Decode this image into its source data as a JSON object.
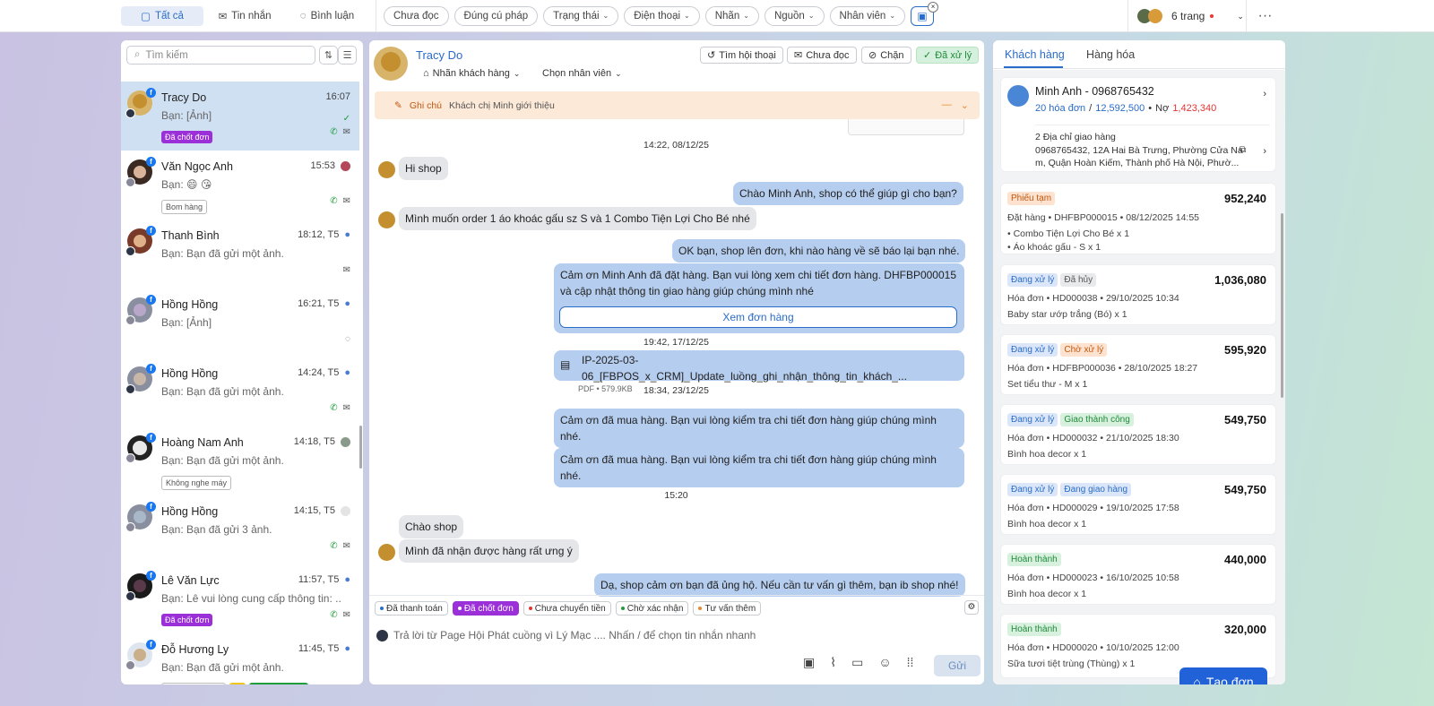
{
  "topbar": {
    "segments": [
      {
        "label": "Tất cả",
        "icon": "chat-bubble-icon"
      },
      {
        "label": "Tin nhắn",
        "icon": "mail-icon"
      },
      {
        "label": "Bình luận",
        "icon": "comment-icon"
      }
    ],
    "filters": [
      "Chưa đọc",
      "Đúng cú pháp",
      "Trạng thái",
      "Điện thoại",
      "Nhãn",
      "Nguồn",
      "Nhân viên"
    ],
    "pages_label": "6 trang",
    "more_label": "···"
  },
  "left": {
    "search_placeholder": "Tìm kiếm",
    "conversations": [
      {
        "name": "Tracy Do",
        "time": "16:07",
        "message": "Bạn: [Ảnh]",
        "tag": "Đã chốt đơn"
      },
      {
        "name": "Văn Ngọc Anh",
        "time": "15:53",
        "message": "Bạn: 😄 😘",
        "tag": "Bom hàng"
      },
      {
        "name": "Thanh Bình",
        "time": "18:12, T5",
        "message": "Bạn: Bạn đã gửi một ảnh.",
        "tag": ""
      },
      {
        "name": "Hồng Hồng",
        "time": "16:21, T5",
        "message": "Bạn: [Ảnh]",
        "tag": ""
      },
      {
        "name": "Hồng Hồng",
        "time": "14:24, T5",
        "message": "Bạn: Bạn đã gửi một ảnh.",
        "tag": ""
      },
      {
        "name": "Hoàng Nam Anh",
        "time": "14:18, T5",
        "message": "Bạn: Bạn đã gửi một ảnh.",
        "tag": "Không nghe máy"
      },
      {
        "name": "Hồng Hồng",
        "time": "14:15, T5",
        "message": "Bạn: Bạn đã gửi 3 ảnh.",
        "tag": ""
      },
      {
        "name": "Lê Văn Lực",
        "time": "11:57, T5",
        "message": "Bạn: Lê vui lòng cung cấp thông tin: ...",
        "tag": "Đã chốt đơn"
      },
      {
        "name": "Đỗ Hương Ly",
        "time": "11:45, T5",
        "message": "Bạn: Bạn đã gửi một ảnh.",
        "tag": ""
      }
    ]
  },
  "chat": {
    "name": "Tracy Do",
    "label_btn": "Nhãn khách hàng",
    "staff_btn": "Chọn nhân viên",
    "actions": [
      "Tìm hội thoại",
      "Chưa đọc",
      "Chặn",
      "Đã xử lý"
    ],
    "note_label": "Ghi chú",
    "note_text": "Khách chị Minh giới thiệu",
    "messages": {
      "ts1": "14:22, 08/12/25",
      "m1": "Hi shop",
      "m2": "Chào Minh Anh, shop có thể giúp gì cho bạn?",
      "m3": "Mình muốn order 1 áo khoác gấu sz S và 1 Combo Tiện Lợi Cho Bé nhé",
      "m4": "OK bạn, shop lên đơn, khi nào hàng về sẽ báo lại bạn nhé.",
      "m5a": "Cảm ơn Minh Anh đã đặt hàng. Bạn vui lòng xem chi tiết đơn hàng. DHFBP000015",
      "m5b": "và cập nhật thông tin giao hàng giúp chúng mình nhé",
      "view_order": "Xem đơn hàng",
      "ts2": "19:42, 17/12/25",
      "file_name": "IP-2025-03-06_[FBPOS_x_CRM]_Update_luồng_ghi_nhận_thông_tin_khách_...",
      "file_meta": "PDF • 579.9KB",
      "ts3": "18:34, 23/12/25",
      "m6a": "Cảm ơn  đã mua hàng. Bạn vui lòng kiểm tra chi tiết đơn hàng giúp chúng mình",
      "m6b": "nhé.",
      "m7a": "Cảm ơn  đã mua hàng. Bạn vui lòng kiểm tra chi tiết đơn hàng giúp chúng mình",
      "m7b": "nhé.",
      "ts4": "15:20",
      "m8": "Chào shop",
      "m9": "Mình đã nhận được hàng rất ưng ý",
      "m10": "Dạ, shop cảm ơn bạn đã ủng hộ. Nếu cần tư vấn gì thêm, bạn ib shop nhé!"
    },
    "quick_tags": [
      {
        "label": "Đã thanh toán",
        "color": "#2a6cc9"
      },
      {
        "label": "Đã chốt đơn",
        "color": "#ffffff"
      },
      {
        "label": "Chưa chuyển tiền",
        "color": "#e33333"
      },
      {
        "label": "Chờ xác nhận",
        "color": "#1f9d3a"
      },
      {
        "label": "Tư vấn thêm",
        "color": "#e8892b"
      }
    ],
    "compose_placeholder": "Trả lời từ Page Hội Phát cuồng vì Lý Mạc .... Nhấn / để chọn tin nhắn nhanh",
    "send_label": "Gửi"
  },
  "right": {
    "tabs": [
      "Khách hàng",
      "Hàng hóa"
    ],
    "customer": {
      "name": "Minh Anh - 0968765432",
      "orders": "20 hóa đơn",
      "total": "12,592,500",
      "debt_label": "Nợ",
      "debt": "1,423,340",
      "address_title": "2 Địa chỉ giao hàng",
      "address_line1": "0968765432, 12A Hai Bà Trưng, Phường Cửa Na",
      "address_line2": "m, Quận Hoàn Kiếm, Thành phố Hà Nội, Phườ..."
    },
    "orders": [
      {
        "badges": [
          "Phiếu tạm"
        ],
        "amount": "952,240",
        "meta": "Đặt hàng • DHFBP000015 • 08/12/2025 14:55",
        "items": [
          "• Combo Tiện Lợi Cho Bé x 1",
          "• Áo khoác gấu - S x 1"
        ]
      },
      {
        "badges": [
          "Đang xử lý",
          "Đã hủy"
        ],
        "amount": "1,036,080",
        "meta": "Hóa đơn • HD000038 • 29/10/2025 10:34",
        "items": [
          "Baby star ướp trắng (Bó) x 1"
        ]
      },
      {
        "badges": [
          "Đang xử lý",
          "Chờ xử lý"
        ],
        "amount": "595,920",
        "meta": "Hóa đơn • HDFBP000036 • 28/10/2025 18:27",
        "items": [
          "Set tiểu thư - M x 1"
        ]
      },
      {
        "badges": [
          "Đang xử lý",
          "Giao thành công"
        ],
        "amount": "549,750",
        "meta": "Hóa đơn • HD000032 • 21/10/2025 18:30",
        "items": [
          "Bình hoa decor x 1"
        ]
      },
      {
        "badges": [
          "Đang xử lý",
          "Đang giao hàng"
        ],
        "amount": "549,750",
        "meta": "Hóa đơn • HD000029 • 19/10/2025 17:58",
        "items": [
          "Bình hoa decor x 1"
        ]
      },
      {
        "badges": [
          "Hoàn thành"
        ],
        "amount": "440,000",
        "meta": "Hóa đơn • HD000023 • 16/10/2025 10:58",
        "items": [
          "Bình hoa decor x 1"
        ]
      },
      {
        "badges": [
          "Hoàn thành"
        ],
        "amount": "320,000",
        "meta": "Hóa đơn • HD000020 • 10/10/2025 12:00",
        "items": [
          "Sữa tươi tiệt trùng (Thùng) x 1"
        ]
      }
    ],
    "create_label": "Tạo đơn"
  }
}
